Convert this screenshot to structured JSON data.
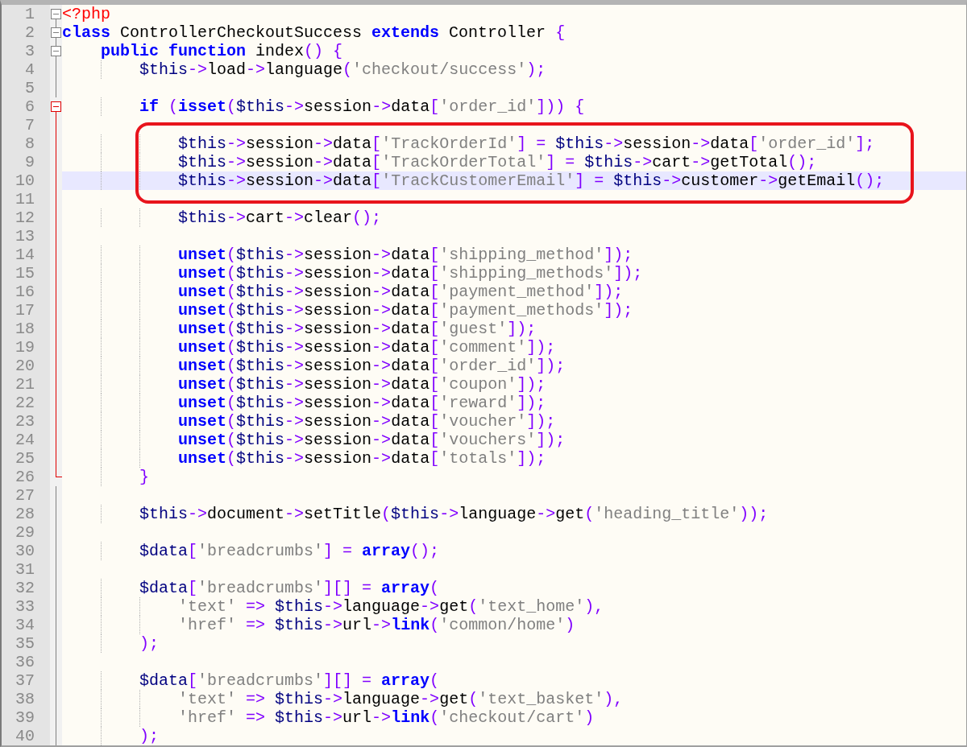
{
  "lines": [
    {
      "number": "1",
      "kind": "fold-start",
      "fold_active": false,
      "current": false,
      "framed": false,
      "tokens": [
        {
          "kind": "tag",
          "text": "<?php"
        }
      ]
    },
    {
      "number": "2",
      "kind": "fold-start",
      "fold_active": false,
      "current": false,
      "framed": false,
      "tokens": [
        {
          "kind": "keyword",
          "text": "class"
        },
        {
          "kind": "name",
          "text": " ControllerCheckoutSuccess "
        },
        {
          "kind": "keyword",
          "text": "extends"
        },
        {
          "kind": "name",
          "text": " Controller "
        },
        {
          "kind": "operator",
          "text": "{"
        }
      ]
    },
    {
      "number": "3",
      "kind": "fold-start",
      "fold_active": false,
      "current": false,
      "framed": false,
      "tokens": [
        {
          "kind": "keyword",
          "text": "    public function"
        },
        {
          "kind": "name",
          "text": " index"
        },
        {
          "kind": "operator",
          "text": "() {"
        }
      ]
    },
    {
      "number": "4",
      "kind": "fold-line",
      "fold_active": false,
      "current": false,
      "framed": false,
      "tokens": [
        {
          "kind": "variable",
          "text": "        $this"
        },
        {
          "kind": "operator",
          "text": "->"
        },
        {
          "kind": "name",
          "text": "load"
        },
        {
          "kind": "operator",
          "text": "->"
        },
        {
          "kind": "name",
          "text": "language"
        },
        {
          "kind": "operator",
          "text": "("
        },
        {
          "kind": "string",
          "text": "'checkout/success'"
        },
        {
          "kind": "operator",
          "text": ");"
        }
      ]
    },
    {
      "number": "5",
      "kind": "fold-line",
      "fold_active": false,
      "current": false,
      "framed": false
    },
    {
      "number": "6",
      "kind": "fold-start",
      "fold_active": true,
      "current": false,
      "framed": false,
      "tokens": [
        {
          "kind": "keyword",
          "text": "        if"
        },
        {
          "kind": "operator",
          "text": " ("
        },
        {
          "kind": "keyword",
          "text": "isset"
        },
        {
          "kind": "operator",
          "text": "("
        },
        {
          "kind": "variable",
          "text": "$this"
        },
        {
          "kind": "operator",
          "text": "->"
        },
        {
          "kind": "name",
          "text": "session"
        },
        {
          "kind": "operator",
          "text": "->"
        },
        {
          "kind": "name",
          "text": "data"
        },
        {
          "kind": "operator",
          "text": "["
        },
        {
          "kind": "string",
          "text": "'order_id'"
        },
        {
          "kind": "operator",
          "text": "])) {"
        }
      ]
    },
    {
      "number": "7",
      "kind": "fold-line",
      "fold_active": true,
      "current": false,
      "framed": false
    },
    {
      "number": "8",
      "kind": "fold-line",
      "fold_active": true,
      "current": false,
      "framed": true,
      "tokens": [
        {
          "kind": "variable",
          "text": "            $this"
        },
        {
          "kind": "operator",
          "text": "->"
        },
        {
          "kind": "name",
          "text": "session"
        },
        {
          "kind": "operator",
          "text": "->"
        },
        {
          "kind": "name",
          "text": "data"
        },
        {
          "kind": "operator",
          "text": "["
        },
        {
          "kind": "string",
          "text": "'TrackOrderId'"
        },
        {
          "kind": "operator",
          "text": "] = "
        },
        {
          "kind": "variable",
          "text": "$this"
        },
        {
          "kind": "operator",
          "text": "->"
        },
        {
          "kind": "name",
          "text": "session"
        },
        {
          "kind": "operator",
          "text": "->"
        },
        {
          "kind": "name",
          "text": "data"
        },
        {
          "kind": "operator",
          "text": "["
        },
        {
          "kind": "string",
          "text": "'order_id'"
        },
        {
          "kind": "operator",
          "text": "];"
        }
      ]
    },
    {
      "number": "9",
      "kind": "fold-line",
      "fold_active": true,
      "current": false,
      "framed": true,
      "tokens": [
        {
          "kind": "variable",
          "text": "            $this"
        },
        {
          "kind": "operator",
          "text": "->"
        },
        {
          "kind": "name",
          "text": "session"
        },
        {
          "kind": "operator",
          "text": "->"
        },
        {
          "kind": "name",
          "text": "data"
        },
        {
          "kind": "operator",
          "text": "["
        },
        {
          "kind": "string",
          "text": "'TrackOrderTotal'"
        },
        {
          "kind": "operator",
          "text": "] = "
        },
        {
          "kind": "variable",
          "text": "$this"
        },
        {
          "kind": "operator",
          "text": "->"
        },
        {
          "kind": "name",
          "text": "cart"
        },
        {
          "kind": "operator",
          "text": "->"
        },
        {
          "kind": "name",
          "text": "getTotal"
        },
        {
          "kind": "operator",
          "text": "();"
        }
      ]
    },
    {
      "number": "10",
      "kind": "fold-line",
      "fold_active": true,
      "current": true,
      "framed": true,
      "tokens": [
        {
          "kind": "variable",
          "text": "            $this"
        },
        {
          "kind": "operator",
          "text": "->"
        },
        {
          "kind": "name",
          "text": "session"
        },
        {
          "kind": "operator",
          "text": "->"
        },
        {
          "kind": "name",
          "text": "data"
        },
        {
          "kind": "operator",
          "text": "["
        },
        {
          "kind": "string",
          "text": "'TrackCustomerEmail'"
        },
        {
          "kind": "operator",
          "text": "] = "
        },
        {
          "kind": "variable",
          "text": "$this"
        },
        {
          "kind": "operator",
          "text": "->"
        },
        {
          "kind": "name",
          "text": "customer"
        },
        {
          "kind": "operator",
          "text": "->"
        },
        {
          "kind": "name",
          "text": "getEmail"
        },
        {
          "kind": "operator",
          "text": "();"
        }
      ]
    },
    {
      "number": "11",
      "kind": "fold-line",
      "fold_active": true,
      "current": false,
      "framed": false
    },
    {
      "number": "12",
      "kind": "fold-line",
      "fold_active": true,
      "current": false,
      "framed": false,
      "tokens": [
        {
          "kind": "variable",
          "text": "            $this"
        },
        {
          "kind": "operator",
          "text": "->"
        },
        {
          "kind": "name",
          "text": "cart"
        },
        {
          "kind": "operator",
          "text": "->"
        },
        {
          "kind": "name",
          "text": "clear"
        },
        {
          "kind": "operator",
          "text": "();"
        }
      ]
    },
    {
      "number": "13",
      "kind": "fold-line",
      "fold_active": true,
      "current": false,
      "framed": false
    },
    {
      "number": "14",
      "kind": "fold-line",
      "fold_active": true,
      "current": false,
      "framed": false,
      "tokens": [
        {
          "kind": "keyword",
          "text": "            unset"
        },
        {
          "kind": "operator",
          "text": "("
        },
        {
          "kind": "variable",
          "text": "$this"
        },
        {
          "kind": "operator",
          "text": "->"
        },
        {
          "kind": "name",
          "text": "session"
        },
        {
          "kind": "operator",
          "text": "->"
        },
        {
          "kind": "name",
          "text": "data"
        },
        {
          "kind": "operator",
          "text": "["
        },
        {
          "kind": "string",
          "text": "'shipping_method'"
        },
        {
          "kind": "operator",
          "text": "]);"
        }
      ]
    },
    {
      "number": "15",
      "kind": "fold-line",
      "fold_active": true,
      "current": false,
      "framed": false,
      "tokens": [
        {
          "kind": "keyword",
          "text": "            unset"
        },
        {
          "kind": "operator",
          "text": "("
        },
        {
          "kind": "variable",
          "text": "$this"
        },
        {
          "kind": "operator",
          "text": "->"
        },
        {
          "kind": "name",
          "text": "session"
        },
        {
          "kind": "operator",
          "text": "->"
        },
        {
          "kind": "name",
          "text": "data"
        },
        {
          "kind": "operator",
          "text": "["
        },
        {
          "kind": "string",
          "text": "'shipping_methods'"
        },
        {
          "kind": "operator",
          "text": "]);"
        }
      ]
    },
    {
      "number": "16",
      "kind": "fold-line",
      "fold_active": true,
      "current": false,
      "framed": false,
      "tokens": [
        {
          "kind": "keyword",
          "text": "            unset"
        },
        {
          "kind": "operator",
          "text": "("
        },
        {
          "kind": "variable",
          "text": "$this"
        },
        {
          "kind": "operator",
          "text": "->"
        },
        {
          "kind": "name",
          "text": "session"
        },
        {
          "kind": "operator",
          "text": "->"
        },
        {
          "kind": "name",
          "text": "data"
        },
        {
          "kind": "operator",
          "text": "["
        },
        {
          "kind": "string",
          "text": "'payment_method'"
        },
        {
          "kind": "operator",
          "text": "]);"
        }
      ]
    },
    {
      "number": "17",
      "kind": "fold-line",
      "fold_active": true,
      "current": false,
      "framed": false,
      "tokens": [
        {
          "kind": "keyword",
          "text": "            unset"
        },
        {
          "kind": "operator",
          "text": "("
        },
        {
          "kind": "variable",
          "text": "$this"
        },
        {
          "kind": "operator",
          "text": "->"
        },
        {
          "kind": "name",
          "text": "session"
        },
        {
          "kind": "operator",
          "text": "->"
        },
        {
          "kind": "name",
          "text": "data"
        },
        {
          "kind": "operator",
          "text": "["
        },
        {
          "kind": "string",
          "text": "'payment_methods'"
        },
        {
          "kind": "operator",
          "text": "]);"
        }
      ]
    },
    {
      "number": "18",
      "kind": "fold-line",
      "fold_active": true,
      "current": false,
      "framed": false,
      "tokens": [
        {
          "kind": "keyword",
          "text": "            unset"
        },
        {
          "kind": "operator",
          "text": "("
        },
        {
          "kind": "variable",
          "text": "$this"
        },
        {
          "kind": "operator",
          "text": "->"
        },
        {
          "kind": "name",
          "text": "session"
        },
        {
          "kind": "operator",
          "text": "->"
        },
        {
          "kind": "name",
          "text": "data"
        },
        {
          "kind": "operator",
          "text": "["
        },
        {
          "kind": "string",
          "text": "'guest'"
        },
        {
          "kind": "operator",
          "text": "]);"
        }
      ]
    },
    {
      "number": "19",
      "kind": "fold-line",
      "fold_active": true,
      "current": false,
      "framed": false,
      "tokens": [
        {
          "kind": "keyword",
          "text": "            unset"
        },
        {
          "kind": "operator",
          "text": "("
        },
        {
          "kind": "variable",
          "text": "$this"
        },
        {
          "kind": "operator",
          "text": "->"
        },
        {
          "kind": "name",
          "text": "session"
        },
        {
          "kind": "operator",
          "text": "->"
        },
        {
          "kind": "name",
          "text": "data"
        },
        {
          "kind": "operator",
          "text": "["
        },
        {
          "kind": "string",
          "text": "'comment'"
        },
        {
          "kind": "operator",
          "text": "]);"
        }
      ]
    },
    {
      "number": "20",
      "kind": "fold-line",
      "fold_active": true,
      "current": false,
      "framed": false,
      "tokens": [
        {
          "kind": "keyword",
          "text": "            unset"
        },
        {
          "kind": "operator",
          "text": "("
        },
        {
          "kind": "variable",
          "text": "$this"
        },
        {
          "kind": "operator",
          "text": "->"
        },
        {
          "kind": "name",
          "text": "session"
        },
        {
          "kind": "operator",
          "text": "->"
        },
        {
          "kind": "name",
          "text": "data"
        },
        {
          "kind": "operator",
          "text": "["
        },
        {
          "kind": "string",
          "text": "'order_id'"
        },
        {
          "kind": "operator",
          "text": "]);"
        }
      ]
    },
    {
      "number": "21",
      "kind": "fold-line",
      "fold_active": true,
      "current": false,
      "framed": false,
      "tokens": [
        {
          "kind": "keyword",
          "text": "            unset"
        },
        {
          "kind": "operator",
          "text": "("
        },
        {
          "kind": "variable",
          "text": "$this"
        },
        {
          "kind": "operator",
          "text": "->"
        },
        {
          "kind": "name",
          "text": "session"
        },
        {
          "kind": "operator",
          "text": "->"
        },
        {
          "kind": "name",
          "text": "data"
        },
        {
          "kind": "operator",
          "text": "["
        },
        {
          "kind": "string",
          "text": "'coupon'"
        },
        {
          "kind": "operator",
          "text": "]);"
        }
      ]
    },
    {
      "number": "22",
      "kind": "fold-line",
      "fold_active": true,
      "current": false,
      "framed": false,
      "tokens": [
        {
          "kind": "keyword",
          "text": "            unset"
        },
        {
          "kind": "operator",
          "text": "("
        },
        {
          "kind": "variable",
          "text": "$this"
        },
        {
          "kind": "operator",
          "text": "->"
        },
        {
          "kind": "name",
          "text": "session"
        },
        {
          "kind": "operator",
          "text": "->"
        },
        {
          "kind": "name",
          "text": "data"
        },
        {
          "kind": "operator",
          "text": "["
        },
        {
          "kind": "string",
          "text": "'reward'"
        },
        {
          "kind": "operator",
          "text": "]);"
        }
      ]
    },
    {
      "number": "23",
      "kind": "fold-line",
      "fold_active": true,
      "current": false,
      "framed": false,
      "tokens": [
        {
          "kind": "keyword",
          "text": "            unset"
        },
        {
          "kind": "operator",
          "text": "("
        },
        {
          "kind": "variable",
          "text": "$this"
        },
        {
          "kind": "operator",
          "text": "->"
        },
        {
          "kind": "name",
          "text": "session"
        },
        {
          "kind": "operator",
          "text": "->"
        },
        {
          "kind": "name",
          "text": "data"
        },
        {
          "kind": "operator",
          "text": "["
        },
        {
          "kind": "string",
          "text": "'voucher'"
        },
        {
          "kind": "operator",
          "text": "]);"
        }
      ]
    },
    {
      "number": "24",
      "kind": "fold-line",
      "fold_active": true,
      "current": false,
      "framed": false,
      "tokens": [
        {
          "kind": "keyword",
          "text": "            unset"
        },
        {
          "kind": "operator",
          "text": "("
        },
        {
          "kind": "variable",
          "text": "$this"
        },
        {
          "kind": "operator",
          "text": "->"
        },
        {
          "kind": "name",
          "text": "session"
        },
        {
          "kind": "operator",
          "text": "->"
        },
        {
          "kind": "name",
          "text": "data"
        },
        {
          "kind": "operator",
          "text": "["
        },
        {
          "kind": "string",
          "text": "'vouchers'"
        },
        {
          "kind": "operator",
          "text": "]);"
        }
      ]
    },
    {
      "number": "25",
      "kind": "fold-line",
      "fold_active": true,
      "current": false,
      "framed": false,
      "tokens": [
        {
          "kind": "keyword",
          "text": "            unset"
        },
        {
          "kind": "operator",
          "text": "("
        },
        {
          "kind": "variable",
          "text": "$this"
        },
        {
          "kind": "operator",
          "text": "->"
        },
        {
          "kind": "name",
          "text": "session"
        },
        {
          "kind": "operator",
          "text": "->"
        },
        {
          "kind": "name",
          "text": "data"
        },
        {
          "kind": "operator",
          "text": "["
        },
        {
          "kind": "string",
          "text": "'totals'"
        },
        {
          "kind": "operator",
          "text": "]);"
        }
      ]
    },
    {
      "number": "26",
      "kind": "fold-end",
      "fold_active": true,
      "current": false,
      "framed": false,
      "tokens": [
        {
          "kind": "operator",
          "text": "        }"
        }
      ]
    },
    {
      "number": "27",
      "kind": "fold-line",
      "fold_active": false,
      "current": false,
      "framed": false
    },
    {
      "number": "28",
      "kind": "fold-line",
      "fold_active": false,
      "current": false,
      "framed": false,
      "tokens": [
        {
          "kind": "variable",
          "text": "        $this"
        },
        {
          "kind": "operator",
          "text": "->"
        },
        {
          "kind": "name",
          "text": "document"
        },
        {
          "kind": "operator",
          "text": "->"
        },
        {
          "kind": "name",
          "text": "setTitle"
        },
        {
          "kind": "operator",
          "text": "("
        },
        {
          "kind": "variable",
          "text": "$this"
        },
        {
          "kind": "operator",
          "text": "->"
        },
        {
          "kind": "name",
          "text": "language"
        },
        {
          "kind": "operator",
          "text": "->"
        },
        {
          "kind": "name",
          "text": "get"
        },
        {
          "kind": "operator",
          "text": "("
        },
        {
          "kind": "string",
          "text": "'heading_title'"
        },
        {
          "kind": "operator",
          "text": "));"
        }
      ]
    },
    {
      "number": "29",
      "kind": "fold-line",
      "fold_active": false,
      "current": false,
      "framed": false
    },
    {
      "number": "30",
      "kind": "fold-line",
      "fold_active": false,
      "current": false,
      "framed": false,
      "tokens": [
        {
          "kind": "variable",
          "text": "        $data"
        },
        {
          "kind": "operator",
          "text": "["
        },
        {
          "kind": "string",
          "text": "'breadcrumbs'"
        },
        {
          "kind": "operator",
          "text": "] = "
        },
        {
          "kind": "keyword",
          "text": "array"
        },
        {
          "kind": "operator",
          "text": "();"
        }
      ]
    },
    {
      "number": "31",
      "kind": "fold-line",
      "fold_active": false,
      "current": false,
      "framed": false
    },
    {
      "number": "32",
      "kind": "fold-line",
      "fold_active": false,
      "current": false,
      "framed": false,
      "tokens": [
        {
          "kind": "variable",
          "text": "        $data"
        },
        {
          "kind": "operator",
          "text": "["
        },
        {
          "kind": "string",
          "text": "'breadcrumbs'"
        },
        {
          "kind": "operator",
          "text": "][] = "
        },
        {
          "kind": "keyword",
          "text": "array"
        },
        {
          "kind": "operator",
          "text": "("
        }
      ]
    },
    {
      "number": "33",
      "kind": "fold-line",
      "fold_active": false,
      "current": false,
      "framed": false,
      "tokens": [
        {
          "kind": "string",
          "text": "            'text'"
        },
        {
          "kind": "operator",
          "text": " => "
        },
        {
          "kind": "variable",
          "text": "$this"
        },
        {
          "kind": "operator",
          "text": "->"
        },
        {
          "kind": "name",
          "text": "language"
        },
        {
          "kind": "operator",
          "text": "->"
        },
        {
          "kind": "name",
          "text": "get"
        },
        {
          "kind": "operator",
          "text": "("
        },
        {
          "kind": "string",
          "text": "'text_home'"
        },
        {
          "kind": "operator",
          "text": "),"
        }
      ]
    },
    {
      "number": "34",
      "kind": "fold-line",
      "fold_active": false,
      "current": false,
      "framed": false,
      "tokens": [
        {
          "kind": "string",
          "text": "            'href'"
        },
        {
          "kind": "operator",
          "text": " => "
        },
        {
          "kind": "variable",
          "text": "$this"
        },
        {
          "kind": "operator",
          "text": "->"
        },
        {
          "kind": "name",
          "text": "url"
        },
        {
          "kind": "operator",
          "text": "->"
        },
        {
          "kind": "keyword",
          "text": "link"
        },
        {
          "kind": "operator",
          "text": "("
        },
        {
          "kind": "string",
          "text": "'common/home'"
        },
        {
          "kind": "operator",
          "text": ")"
        }
      ]
    },
    {
      "number": "35",
      "kind": "fold-line",
      "fold_active": false,
      "current": false,
      "framed": false,
      "tokens": [
        {
          "kind": "operator",
          "text": "        );"
        }
      ]
    },
    {
      "number": "36",
      "kind": "fold-line",
      "fold_active": false,
      "current": false,
      "framed": false
    },
    {
      "number": "37",
      "kind": "fold-line",
      "fold_active": false,
      "current": false,
      "framed": false,
      "tokens": [
        {
          "kind": "variable",
          "text": "        $data"
        },
        {
          "kind": "operator",
          "text": "["
        },
        {
          "kind": "string",
          "text": "'breadcrumbs'"
        },
        {
          "kind": "operator",
          "text": "][] = "
        },
        {
          "kind": "keyword",
          "text": "array"
        },
        {
          "kind": "operator",
          "text": "("
        }
      ]
    },
    {
      "number": "38",
      "kind": "fold-line",
      "fold_active": false,
      "current": false,
      "framed": false,
      "tokens": [
        {
          "kind": "string",
          "text": "            'text'"
        },
        {
          "kind": "operator",
          "text": " => "
        },
        {
          "kind": "variable",
          "text": "$this"
        },
        {
          "kind": "operator",
          "text": "->"
        },
        {
          "kind": "name",
          "text": "language"
        },
        {
          "kind": "operator",
          "text": "->"
        },
        {
          "kind": "name",
          "text": "get"
        },
        {
          "kind": "operator",
          "text": "("
        },
        {
          "kind": "string",
          "text": "'text_basket'"
        },
        {
          "kind": "operator",
          "text": "),"
        }
      ]
    },
    {
      "number": "39",
      "kind": "fold-line",
      "fold_active": false,
      "current": false,
      "framed": false,
      "tokens": [
        {
          "kind": "string",
          "text": "            'href'"
        },
        {
          "kind": "operator",
          "text": " => "
        },
        {
          "kind": "variable",
          "text": "$this"
        },
        {
          "kind": "operator",
          "text": "->"
        },
        {
          "kind": "name",
          "text": "url"
        },
        {
          "kind": "operator",
          "text": "->"
        },
        {
          "kind": "keyword",
          "text": "link"
        },
        {
          "kind": "operator",
          "text": "("
        },
        {
          "kind": "string",
          "text": "'checkout/cart'"
        },
        {
          "kind": "operator",
          "text": ")"
        }
      ]
    },
    {
      "number": "40",
      "kind": "fold-line",
      "fold_active": false,
      "current": false,
      "framed": false,
      "tokens": [
        {
          "kind": "operator",
          "text": "        );"
        }
      ]
    }
  ]
}
